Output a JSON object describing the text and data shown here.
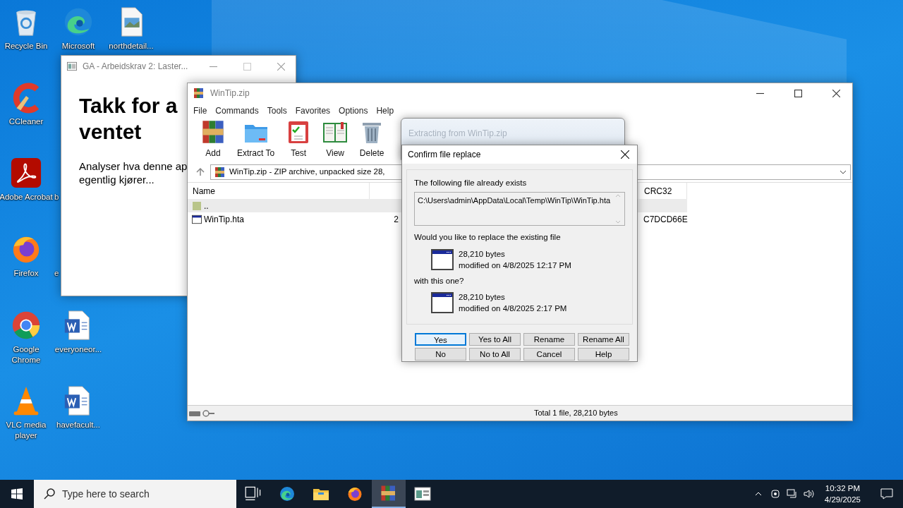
{
  "desktop_icons": [
    {
      "label": "Recycle Bin",
      "kind": "recycle"
    },
    {
      "label": "CCleaner",
      "kind": "ccleaner"
    },
    {
      "label": "Adobe Acrobat",
      "kind": "acrobat"
    },
    {
      "label": "Firefox",
      "kind": "firefox"
    },
    {
      "label": "Google Chrome",
      "kind": "chrome"
    },
    {
      "label": "VLC media player",
      "kind": "vlc"
    },
    {
      "label": "Microsoft",
      "kind": "edge"
    },
    {
      "label": "b",
      "kind": "hidden"
    },
    {
      "label": "e",
      "kind": "hidden"
    },
    {
      "label": "everyoneor...",
      "kind": "word"
    },
    {
      "label": "havefacult...",
      "kind": "word"
    },
    {
      "label": "northdetail...",
      "kind": "image"
    }
  ],
  "browser_window": {
    "title": "GA - Arbeidskrav 2: Laster...",
    "heading": "Takk for a\nventet",
    "paragraph": "Analyser hva denne ap\negentlig kjører..."
  },
  "archiver_window": {
    "title": "WinTip.zip",
    "menu": [
      "File",
      "Commands",
      "Tools",
      "Favorites",
      "Options",
      "Help"
    ],
    "toolbar": [
      {
        "label": "Add",
        "kind": "add"
      },
      {
        "label": "Extract To",
        "kind": "extract"
      },
      {
        "label": "Test",
        "kind": "test"
      },
      {
        "label": "View",
        "kind": "view"
      },
      {
        "label": "Delete",
        "kind": "delete"
      }
    ],
    "address": "WinTip.zip - ZIP archive, unpacked size 28,",
    "columns": [
      "Name",
      "CRC32"
    ],
    "rows": [
      {
        "name": "..",
        "kind": "folder",
        "selected": true
      },
      {
        "name": "WinTip.hta",
        "kind": "hta",
        "column_2": "2",
        "crc": "C7DCD66E",
        "selected": false
      }
    ],
    "status_text": "Total 1 file, 28,210 bytes"
  },
  "progress_dialog": {
    "title": "Extracting from WinTip.zip"
  },
  "confirm_dialog": {
    "title": "Confirm file replace",
    "exists_label": "The following file already exists",
    "path": "C:\\Users\\admin\\AppData\\Local\\Temp\\WinTip\\WinTip.hta",
    "question": "Would you like to replace the existing file",
    "existing": {
      "size": "28,210 bytes",
      "modified": "modified on 4/8/2025 12:17 PM"
    },
    "with_label": "with this one?",
    "incoming": {
      "size": "28,210 bytes",
      "modified": "modified on 4/8/2025 2:17 PM"
    },
    "buttons": [
      {
        "label": "Yes",
        "default": true
      },
      {
        "label": "Yes to All",
        "default": false
      },
      {
        "label": "Rename",
        "default": false
      },
      {
        "label": "Rename All",
        "default": false
      },
      {
        "label": "No",
        "default": false
      },
      {
        "label": "No to All",
        "default": false
      },
      {
        "label": "Cancel",
        "default": false
      },
      {
        "label": "Help",
        "default": false
      }
    ]
  },
  "taskbar": {
    "search_placeholder": "Type here to search",
    "apps": [
      {
        "kind": "taskview",
        "active": false
      },
      {
        "kind": "edge",
        "active": false
      },
      {
        "kind": "explorer",
        "active": false
      },
      {
        "kind": "firefox",
        "active": false
      },
      {
        "kind": "winrar",
        "active": true
      },
      {
        "kind": "window",
        "active": false
      }
    ],
    "time": "10:32 PM",
    "date": "4/29/2025"
  }
}
